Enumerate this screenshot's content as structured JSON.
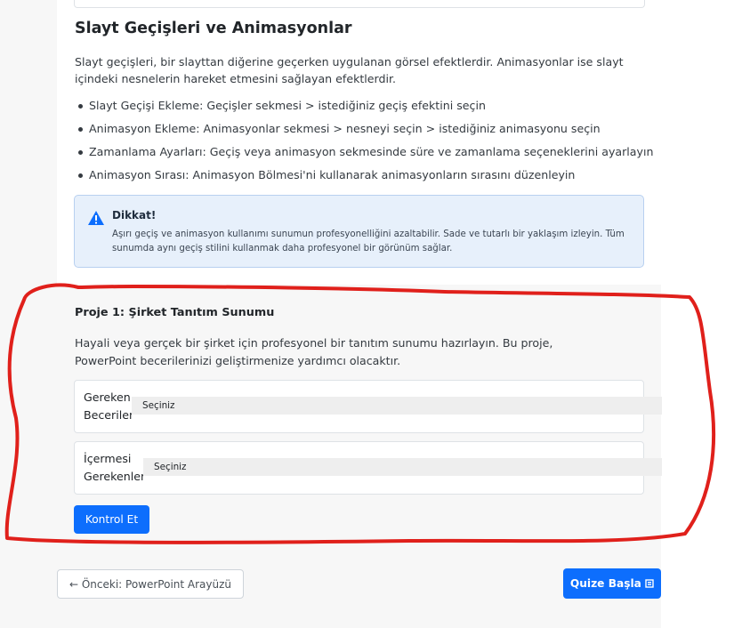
{
  "section": {
    "title": "Slayt Geçişleri ve Animasyonlar",
    "intro": "Slayt geçişleri, bir slayttan diğerine geçerken uygulanan görsel efektlerdir. Animasyonlar ise slayt içindeki nesnelerin hareket etmesini sağlayan efektlerdir.",
    "bullets": [
      "Slayt Geçişi Ekleme: Geçişler sekmesi > istediğiniz geçiş efektini seçin",
      "Animasyon Ekleme: Animasyonlar sekmesi > nesneyi seçin > istediğiniz animasyonu seçin",
      "Zamanlama Ayarları: Geçiş veya animasyon sekmesinde süre ve zamanlama seçeneklerini ayarlayın",
      "Animasyon Sırası: Animasyon Bölmesi'ni kullanarak animasyonların sırasını düzenleyin"
    ]
  },
  "alert": {
    "icon": "warning-triangle-icon",
    "title": "Dikkat!",
    "text": "Aşırı geçiş ve animasyon kullanımı sunumun profesyonelliğini azaltabilir. Sade ve tutarlı bir yaklaşım izleyin. Tüm sunumda aynı geçiş stilini kullanmak daha profesyonel bir görünüm sağlar."
  },
  "project": {
    "title": "Proje 1: Şirket Tanıtım Sunumu",
    "description": "Hayali veya gerçek bir şirket için profesyonel bir tanıtım sunumu hazırlayın. Bu proje, PowerPoint becerilerinizi geliştirmenize yardımcı olacaktır.",
    "fields": [
      {
        "label_line1": "Gereken",
        "label_line2": "Beceriler",
        "select_value": "Seçiniz"
      },
      {
        "label_line1": "İçermesi",
        "label_line2": "Gerekenler",
        "select_value": "Seçiniz"
      }
    ],
    "check_button": "Kontrol Et"
  },
  "nav": {
    "prev_button": "← Önceki: PowerPoint Arayüzü",
    "quiz_button": "Quize Başla",
    "quiz_icon": "book-icon"
  },
  "colors": {
    "primary": "#0d6efd",
    "annotation": "#e0201b",
    "alert_bg": "#e7f0fb"
  }
}
